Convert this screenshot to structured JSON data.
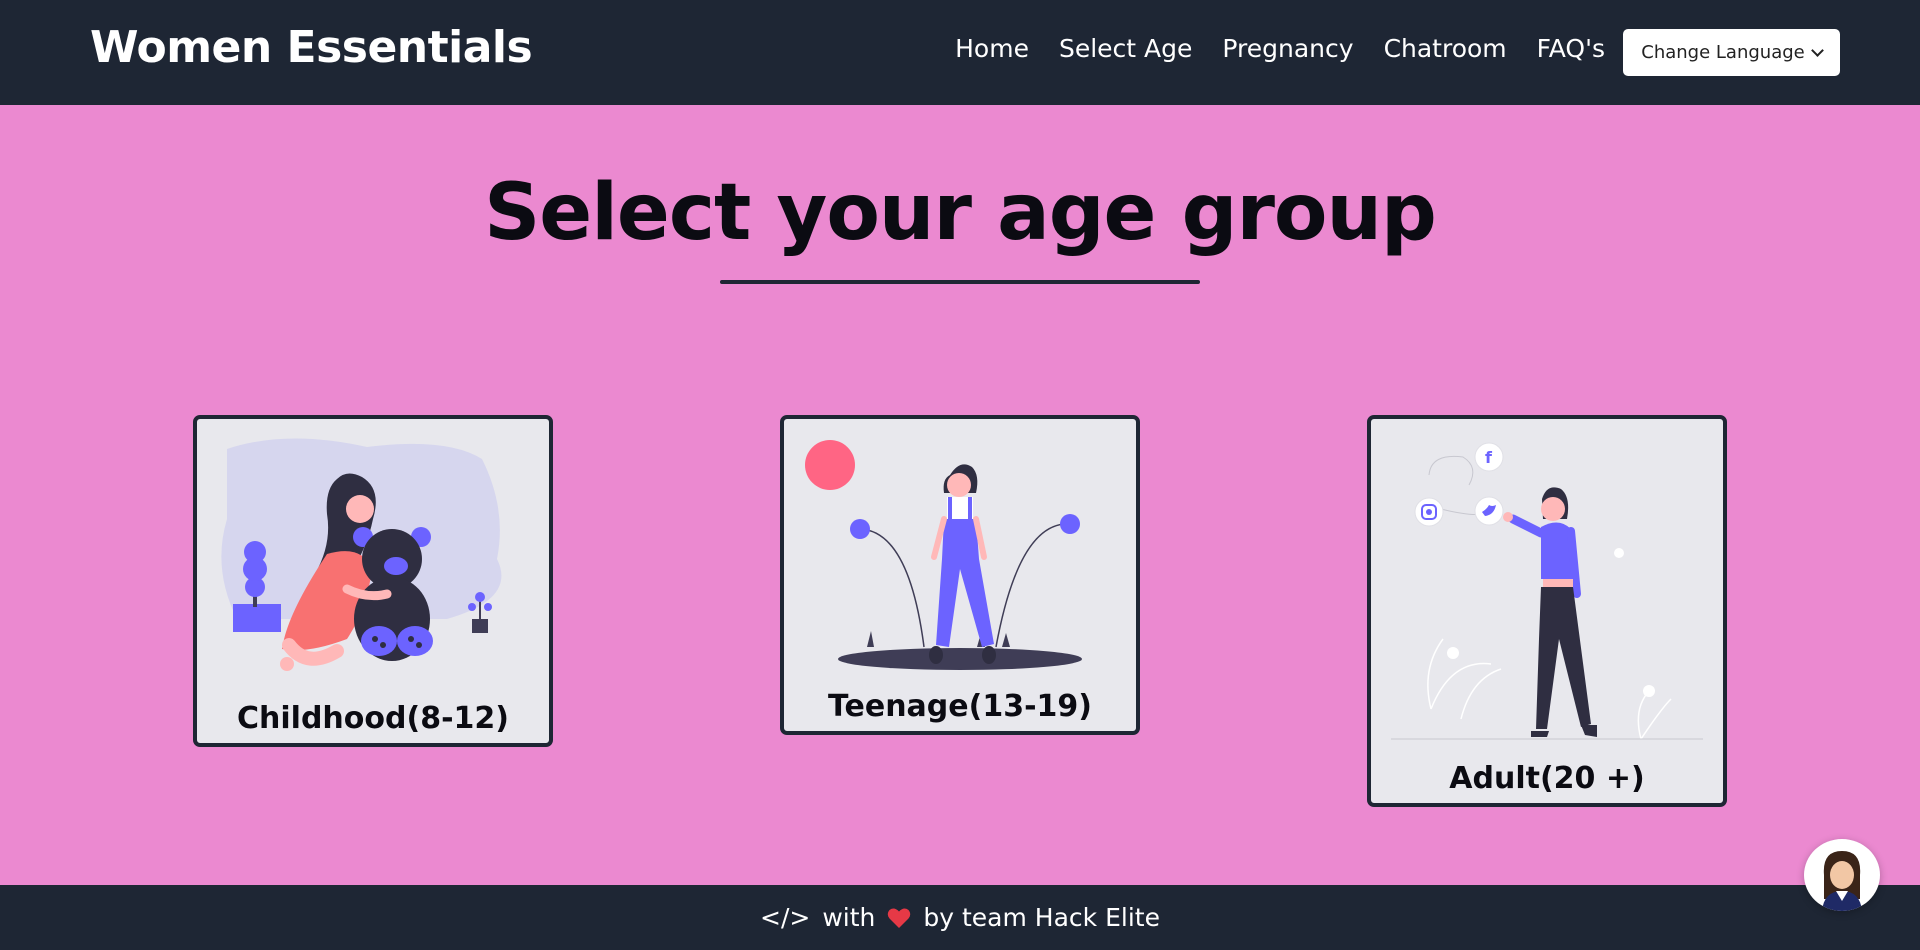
{
  "brand": "Women Essentials",
  "nav": {
    "links": [
      "Home",
      "Select Age",
      "Pregnancy",
      "Chatroom",
      "FAQ's"
    ],
    "language_button": "Change Language"
  },
  "main": {
    "title": "Select your age group",
    "cards": [
      {
        "label": "Childhood(8-12)"
      },
      {
        "label": "Teenage(13-19)"
      },
      {
        "label": "Adult(20 +)"
      }
    ]
  },
  "footer": {
    "code_symbol": "</>",
    "with_text": "with",
    "credit": "by team Hack Elite"
  },
  "colors": {
    "navbar_bg": "#1e2634",
    "page_bg": "#eb89d0",
    "card_bg": "#e8e8ed",
    "accent_purple": "#6c63ff",
    "heart_red": "#e63946"
  },
  "icons": {
    "dropdown": "chevron-down-icon",
    "heart": "heart-icon",
    "chatbot": "chatbot-avatar-icon",
    "facebook": "facebook-icon",
    "twitter": "twitter-icon",
    "instagram": "instagram-icon"
  }
}
